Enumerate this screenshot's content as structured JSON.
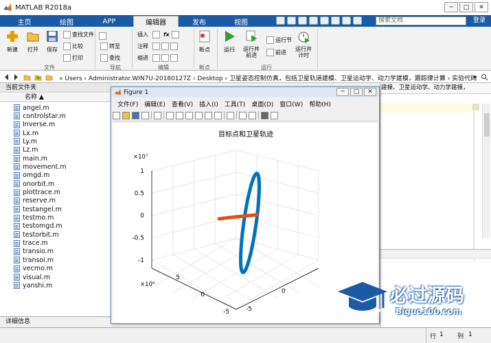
{
  "window": {
    "title": "MATLAB R2018a",
    "min": "─",
    "max": "□",
    "close": "✕"
  },
  "tabs": [
    {
      "label": "主页"
    },
    {
      "label": "绘图"
    },
    {
      "label": "APP"
    },
    {
      "label": "编辑器"
    },
    {
      "label": "发布"
    },
    {
      "label": "视图"
    }
  ],
  "search": {
    "placeholder": "搜索文档",
    "button": "登录"
  },
  "ribbon": {
    "new": "新建",
    "open": "打开",
    "save": "保存",
    "findfile": "查找文件",
    "compare": "比较",
    "print": "打印",
    "goto": "转至",
    "find": "查找",
    "insert": "插入",
    "comment": "注释",
    "indent": "缩进",
    "breakpoint": "断点",
    "run": "运行",
    "runadvance": "运行并\n前进",
    "runsection": "运行节",
    "advance": "前进",
    "runtime": "运行并\n计时",
    "groups": {
      "file": "文件",
      "nav": "导航",
      "edit": "编辑",
      "bp": "断点",
      "run": "运行"
    }
  },
  "address": {
    "path": "« Users  ›  Administrator.WIN7U-20180127Z  ›  Desktop  ›  卫星姿态控制仿真，包括卫星轨道建模、卫星运动学、动力学建模，跟踪律计算  ›  实验代码"
  },
  "leftpanel": {
    "title": "当前文件夹",
    "colname": "名称 ▲",
    "files": [
      "angel.m",
      "controlstar.m",
      "Inverse.m",
      "Lx.m",
      "Ly.m",
      "Lz.m",
      "main.m",
      "movement.m",
      "omgd.m",
      "onorbit.m",
      "plottrace.m",
      "reserve.m",
      "testangel.m",
      "testmo.m",
      "testomgd.m",
      "testorbit.m",
      "trace.m",
      "transio.m",
      "transoi.m",
      "vecmo.m",
      "visual.m",
      "yanshi.m"
    ],
    "detail": "详细信息"
  },
  "rightpanel": {
    "partial": "建模、卫星运动学、动力学建模，"
  },
  "statusbar": {
    "row_label": "行",
    "row": "1",
    "col_label": "列",
    "col": "1"
  },
  "figure": {
    "title": "Figure 1",
    "menu": [
      "文件(F)",
      "编辑(E)",
      "查看(V)",
      "插入(I)",
      "工具(T)",
      "桌面(D)",
      "窗口(W)",
      "帮助(H)"
    ],
    "plot_title": "目标点和卫星轨迹",
    "z_exp": "×10⁷",
    "x_exp": "×10⁶",
    "y_exp": "×10⁶",
    "z_ticks": [
      "1",
      "0.5",
      "0",
      "-0.5",
      "-1"
    ],
    "x_ticks": [
      "5",
      "0",
      "-5"
    ],
    "y_ticks": [
      "0",
      "-5"
    ],
    "colors": {
      "target": "#d95319",
      "orbit": "#0072bd"
    }
  },
  "chart_data": {
    "type": "line",
    "title": "目标点和卫星轨迹",
    "zlim": [
      -1,
      1
    ],
    "z_scale": "1e7",
    "xlim": [
      -5,
      5
    ],
    "x_scale": "1e6",
    "series": [
      {
        "values": "orbit ellipse"
      },
      {
        "values": "target line"
      }
    ]
  },
  "watermark": {
    "text": "必过源码",
    "sub": "Biguo100.com"
  }
}
